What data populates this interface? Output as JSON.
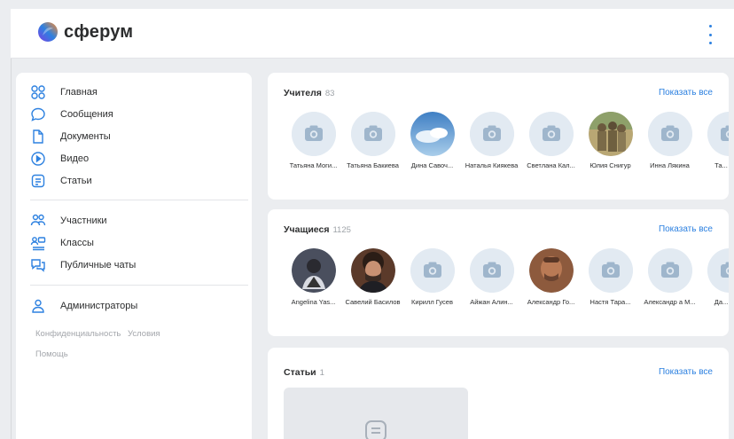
{
  "app": {
    "logo_text": "сферум",
    "colors": {
      "accent": "#2d81e0",
      "background": "#ebedf0",
      "placeholder_avatar": "#e2eaf2"
    }
  },
  "sidebar": {
    "items": [
      {
        "label": "Главная",
        "icon": "grid-icon"
      },
      {
        "label": "Сообщения",
        "icon": "chat-bubble-icon"
      },
      {
        "label": "Документы",
        "icon": "document-icon"
      },
      {
        "label": "Видео",
        "icon": "play-circle-icon"
      },
      {
        "label": "Статьи",
        "icon": "article-icon"
      },
      {
        "label": "Участники",
        "icon": "users-icon"
      },
      {
        "label": "Классы",
        "icon": "classes-icon"
      },
      {
        "label": "Публичные чаты",
        "icon": "public-chats-icon"
      },
      {
        "label": "Администраторы",
        "icon": "admin-user-icon"
      }
    ],
    "footer": {
      "privacy": "Конфиденциальность",
      "terms": "Условия",
      "help": "Помощь"
    }
  },
  "teachers": {
    "title": "Учителя",
    "count": "83",
    "show_all": "Показать все",
    "people": [
      {
        "name": "Татьяна Моги...",
        "photo": false
      },
      {
        "name": "Татьяна Бакиева",
        "photo": false
      },
      {
        "name": "Дина Савоч...",
        "photo": "sky"
      },
      {
        "name": "Наталья Киякева",
        "photo": false
      },
      {
        "name": "Светлана Кал...",
        "photo": false
      },
      {
        "name": "Юлия Снигур",
        "photo": "group"
      },
      {
        "name": "Инна Лякина",
        "photo": false
      },
      {
        "name": "Та... Са...",
        "photo": false
      }
    ]
  },
  "students": {
    "title": "Учащиеся",
    "count": "1125",
    "show_all": "Показать все",
    "people": [
      {
        "name": "Angelina Yas...",
        "photo": "dark"
      },
      {
        "name": "Савелий Басилов",
        "photo": "face"
      },
      {
        "name": "Кирилл Гусев",
        "photo": false
      },
      {
        "name": "Айжан Алин...",
        "photo": false
      },
      {
        "name": "Александр Го...",
        "photo": "face2"
      },
      {
        "name": "Настя Тара...",
        "photo": false
      },
      {
        "name": "Александр а М...",
        "photo": false
      },
      {
        "name": "Да... Се...",
        "photo": false
      }
    ]
  },
  "articles": {
    "title": "Статьи",
    "count": "1",
    "show_all": "Показать все"
  }
}
